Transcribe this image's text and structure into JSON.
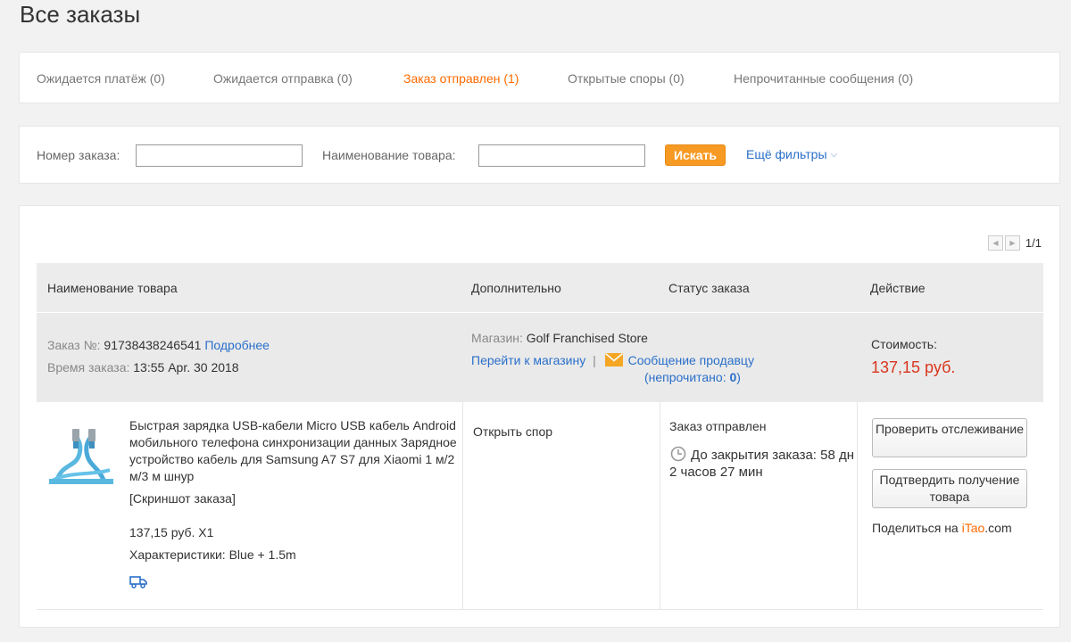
{
  "page": {
    "title": "Все заказы"
  },
  "tabs": [
    {
      "label": "Ожидается платёж (0)"
    },
    {
      "label": "Ожидается отправка (0)"
    },
    {
      "label": "Заказ отправлен (1)"
    },
    {
      "label": "Открытые споры (0)"
    },
    {
      "label": "Непрочитанные сообщения (0)"
    }
  ],
  "filters": {
    "order_number_label": "Номер заказа:",
    "order_number_value": "",
    "product_name_label": "Наименование товара:",
    "product_name_value": "",
    "search_label": "Искать",
    "more_filters_label": "Ещё фильтры"
  },
  "pagination": {
    "text": "1/1"
  },
  "table": {
    "headers": [
      "Наименование товара",
      "Дополнительно",
      "Статус заказа",
      "Действие"
    ]
  },
  "order": {
    "number_label": "Заказ №:",
    "number": "91738438246541",
    "details_link": "Подробнее",
    "time_label": "Время заказа:",
    "time": "13:55 Apr. 30 2018",
    "store_label": "Магазин:",
    "store_name": "Golf Franchised Store",
    "go_to_store": "Перейти к магазину",
    "separator": "|",
    "message_seller": "Сообщение продавцу",
    "unread_prefix": "(непрочитано: ",
    "unread_count": "0",
    "unread_suffix": ")",
    "cost_label": "Стоимость:",
    "cost": "137,15 руб.",
    "product_title": "Быстрая зарядка USB-кабели Micro USB кабель Android мобильного телефона синхронизации данных Зарядное устройство кабель для Samsung A7 S7 для Xiaomi 1 м/2 м/3 м шнур",
    "screenshot_link": "[Скриншот заказа]",
    "price_qty": "137,15 руб. X1",
    "characteristics": "Характеристики: Blue + 1.5m",
    "open_dispute": "Открыть спор",
    "status": "Заказ отправлен",
    "countdown": "До закрытия заказа: 58 дн 2 часов 27 мин",
    "check_tracking": "Проверить отслеживание",
    "confirm_receipt": "Подтвердить получение товара",
    "share_prefix": "Поделиться на ",
    "share_itao": "iTao",
    "share_suffix": ".com"
  },
  "colors": {
    "accent": "#ff6a00",
    "link": "#2a6fc9",
    "price": "#d9361e",
    "search_button": "#f79a24"
  }
}
